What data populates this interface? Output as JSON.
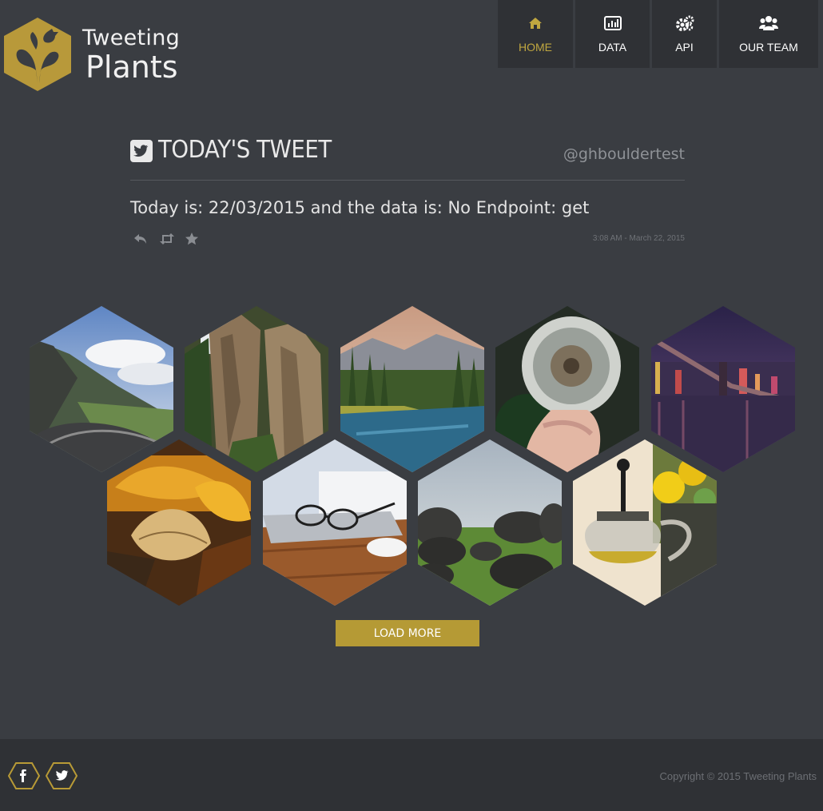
{
  "brand": {
    "line1": "Tweeting",
    "line2": "Plants"
  },
  "nav": [
    {
      "label": "HOME",
      "icon": "home-icon",
      "active": true
    },
    {
      "label": "DATA",
      "icon": "bar-chart-icon",
      "active": false
    },
    {
      "label": "API",
      "icon": "gears-icon",
      "active": false
    },
    {
      "label": "OUR TEAM",
      "icon": "users-icon",
      "active": false
    }
  ],
  "tweet": {
    "title": "TODAY'S TWEET",
    "handle": "@ghbouldertest",
    "text": "Today is: 22/03/2015 and the data is: No Endpoint: get",
    "timestamp": "3:08 AM - March 22, 2015"
  },
  "gallery": {
    "images": [
      "mountain-road",
      "rock-cliffs",
      "lake-forest",
      "dandelion",
      "bridge-night",
      "autumn-leaves",
      "glasses-laptop",
      "stones-grass",
      "teapot-flowers"
    ]
  },
  "load_more_label": "LOAD MORE",
  "footer": {
    "copyright": "Copyright © 2015 Tweeting Plants"
  },
  "colors": {
    "accent": "#c0a740",
    "background": "#3a3d42",
    "panel": "#2f3135"
  }
}
